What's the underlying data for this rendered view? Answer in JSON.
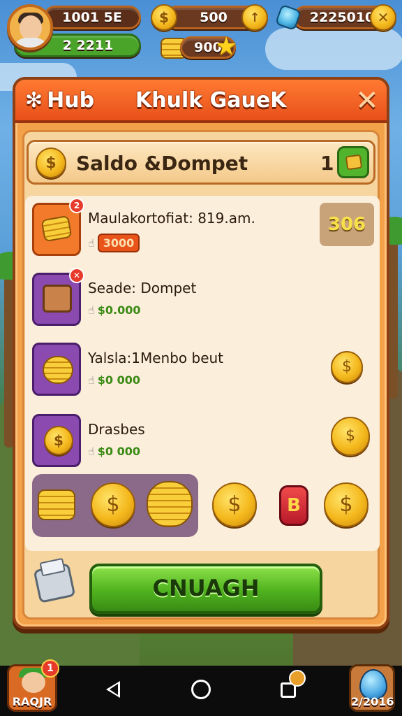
{
  "hud": {
    "player_stat": "1001 5E",
    "player_level": "2 2211",
    "coins": "500",
    "bundle_count": "900",
    "gems": "2225010"
  },
  "panel": {
    "hub_label": "Hub",
    "title": "Khulk GaueK",
    "close_symbol": "✕"
  },
  "wallet": {
    "title": "Saldo &Dompet",
    "count": "1"
  },
  "items": [
    {
      "name": "Maulakortofiat: 819.am.",
      "price": "3000",
      "right_value": "306",
      "badge": "2",
      "icon": "gold-bundle-icon"
    },
    {
      "name": "Seade: Dompet",
      "price": "$0.000",
      "badge": "✕",
      "icon": "treasure-box-icon"
    },
    {
      "name": "Yalsla:1Menbo beut",
      "price": "$0 000",
      "icon": "coin-stack-icon"
    },
    {
      "name": "Drasbes",
      "price": "$0 000",
      "icon": "coins-pile-icon"
    }
  ],
  "tray": {
    "ruby_symbol": "B",
    "coin_symbol": "$"
  },
  "main_button": "CNUAGH",
  "bottom": {
    "left_label": "RAQJR",
    "left_badge": "1",
    "right_label": "2/2016"
  }
}
